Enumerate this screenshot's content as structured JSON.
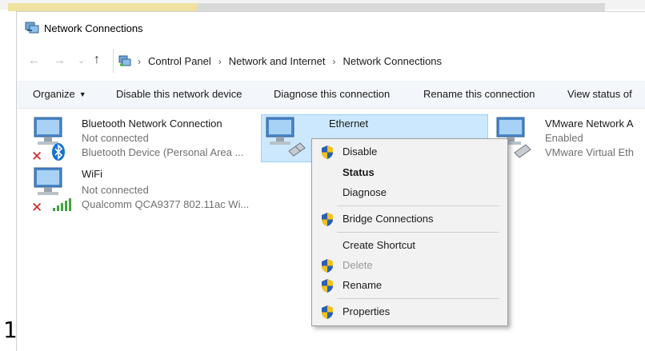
{
  "window": {
    "title": "Network Connections",
    "icon": "network-connections-icon"
  },
  "nav": {
    "back": "←",
    "forward": "→",
    "recent": "⌄",
    "up": "↑"
  },
  "address": {
    "crumbs": [
      "Control Panel",
      "Network and Internet",
      "Network Connections"
    ],
    "separator": "›"
  },
  "toolbar": {
    "organize": "Organize",
    "disable": "Disable this network device",
    "diagnose": "Diagnose this connection",
    "rename": "Rename this connection",
    "view_status": "View status of"
  },
  "connections": [
    {
      "name": "Bluetooth Network Connection",
      "status": "Not connected",
      "device": "Bluetooth Device (Personal Area ..."
    },
    {
      "name": "Ethernet",
      "status": "",
      "device": ""
    },
    {
      "name": "VMware Network A",
      "status": "Enabled",
      "device": "VMware Virtual Eth"
    },
    {
      "name": "WiFi",
      "status": "Not connected",
      "device": "Qualcomm QCA9377 802.11ac Wi..."
    }
  ],
  "context_menu": {
    "items": [
      {
        "label": "Disable",
        "shield": true,
        "bold": false,
        "disabled": false
      },
      {
        "label": "Status",
        "shield": false,
        "bold": true,
        "disabled": false
      },
      {
        "label": "Diagnose",
        "shield": false,
        "bold": false,
        "disabled": false
      },
      {
        "label": "Bridge Connections",
        "shield": true,
        "bold": false,
        "disabled": false
      },
      {
        "label": "Create Shortcut",
        "shield": false,
        "bold": false,
        "disabled": false
      },
      {
        "label": "Delete",
        "shield": true,
        "bold": false,
        "disabled": true
      },
      {
        "label": "Rename",
        "shield": true,
        "bold": false,
        "disabled": false
      },
      {
        "label": "Properties",
        "shield": true,
        "bold": false,
        "disabled": false
      }
    ]
  },
  "colors": {
    "selection_bg": "#cce8ff",
    "selection_border": "#99d1ff",
    "toolbar_bg": "#f3f6fa",
    "menu_bg": "#f2f2f2",
    "shield_blue": "#2b5fb5",
    "shield_yellow": "#f3c318",
    "error_red": "#d32020",
    "bluetooth_blue": "#1174d4",
    "wifi_green": "#3da53d"
  },
  "background_text": "1"
}
